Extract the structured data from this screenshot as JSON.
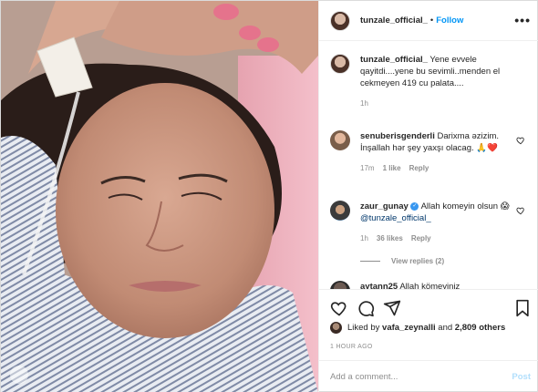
{
  "post": {
    "username": "tunzale_official_",
    "follow_label": "Follow",
    "dot": "•",
    "more_label": "•••"
  },
  "caption": {
    "username": "tunzale_official_",
    "text": "Yene evvele qayitdi....yene bu sevimli..menden el cekmeyen 419 cu palata....",
    "time": "1h"
  },
  "comments": [
    {
      "username": "senuberisgenderli",
      "text": "Darixma əzizim. İnşallah hər şey yaxşı olacag. 🙏❤️",
      "time": "17m",
      "likes": "1 like",
      "reply": "Reply"
    },
    {
      "username": "zaur_gunay",
      "text_pre": "Allah komeyin olsun 😱 ",
      "mention": "@tunzale_official_",
      "time": "1h",
      "likes": "36 likes",
      "reply": "Reply"
    },
    {
      "username": "aytann25",
      "text": "Allah kömeyiniz"
    }
  ],
  "view_replies": "View replies (2)",
  "liked_by": {
    "prefix": "Liked by ",
    "user": "vafa_zeynalli",
    "middle": " and ",
    "others": "2,809 others"
  },
  "timestamp": "1 HOUR AGO",
  "add_comment": {
    "placeholder": "Add a comment...",
    "post_label": "Post"
  },
  "colors": {
    "link": "#0095f6",
    "muted": "#8e8e8e",
    "heart": "#ed4956"
  }
}
